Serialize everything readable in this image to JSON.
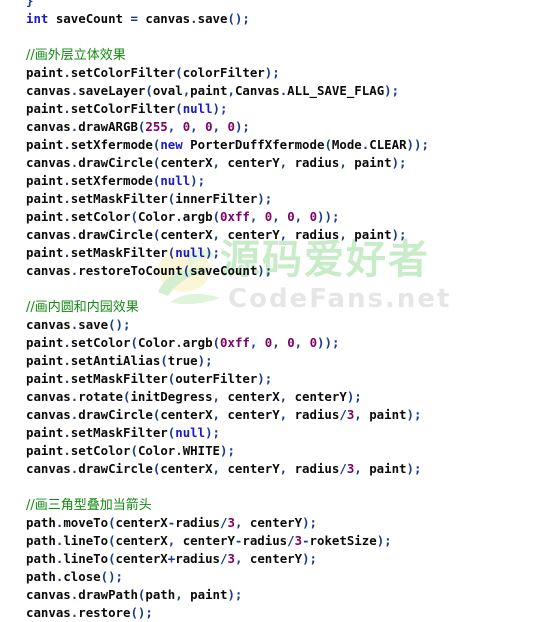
{
  "colors": {
    "keyword": "#1a1acc",
    "number": "#800066",
    "punctuation": "#1a3a8a",
    "identifier": "#0a0a0a",
    "comment": "#138a13",
    "watermark_cn": "#c8ebc8",
    "watermark_en": "#e6e6e6",
    "background": "#ffffff"
  },
  "watermark": {
    "logo_icon": "leaf-logo-icon",
    "chinese_text": "源码爱好者",
    "english_text": "CodeFans.net"
  },
  "code_lines": [
    [
      {
        "t": "p",
        "v": "}"
      }
    ],
    [
      {
        "t": "k",
        "v": "int"
      },
      {
        "t": "i",
        "v": " saveCount "
      },
      {
        "t": "p",
        "v": "="
      },
      {
        "t": "i",
        "v": " canvas"
      },
      {
        "t": "p",
        "v": "."
      },
      {
        "t": "i",
        "v": "save"
      },
      {
        "t": "p",
        "v": "();"
      }
    ],
    [],
    [
      {
        "t": "c",
        "v": "//画外层立体效果"
      }
    ],
    [
      {
        "t": "i",
        "v": "paint"
      },
      {
        "t": "p",
        "v": "."
      },
      {
        "t": "i",
        "v": "setColorFilter"
      },
      {
        "t": "p",
        "v": "("
      },
      {
        "t": "i",
        "v": "colorFilter"
      },
      {
        "t": "p",
        "v": ");"
      }
    ],
    [
      {
        "t": "i",
        "v": "canvas"
      },
      {
        "t": "p",
        "v": "."
      },
      {
        "t": "i",
        "v": "saveLayer"
      },
      {
        "t": "p",
        "v": "("
      },
      {
        "t": "i",
        "v": "oval"
      },
      {
        "t": "p",
        "v": ","
      },
      {
        "t": "i",
        "v": "paint"
      },
      {
        "t": "p",
        "v": ","
      },
      {
        "t": "i",
        "v": "Canvas"
      },
      {
        "t": "p",
        "v": "."
      },
      {
        "t": "i",
        "v": "ALL_SAVE_FLAG"
      },
      {
        "t": "p",
        "v": ");"
      }
    ],
    [
      {
        "t": "i",
        "v": "paint"
      },
      {
        "t": "p",
        "v": "."
      },
      {
        "t": "i",
        "v": "setColorFilter"
      },
      {
        "t": "p",
        "v": "("
      },
      {
        "t": "k",
        "v": "null"
      },
      {
        "t": "p",
        "v": ");"
      }
    ],
    [
      {
        "t": "i",
        "v": "canvas"
      },
      {
        "t": "p",
        "v": "."
      },
      {
        "t": "i",
        "v": "drawARGB"
      },
      {
        "t": "p",
        "v": "("
      },
      {
        "t": "n",
        "v": "255"
      },
      {
        "t": "p",
        "v": ", "
      },
      {
        "t": "n",
        "v": "0"
      },
      {
        "t": "p",
        "v": ", "
      },
      {
        "t": "n",
        "v": "0"
      },
      {
        "t": "p",
        "v": ", "
      },
      {
        "t": "n",
        "v": "0"
      },
      {
        "t": "p",
        "v": ");"
      }
    ],
    [
      {
        "t": "i",
        "v": "paint"
      },
      {
        "t": "p",
        "v": "."
      },
      {
        "t": "i",
        "v": "setXfermode"
      },
      {
        "t": "p",
        "v": "("
      },
      {
        "t": "k",
        "v": "new"
      },
      {
        "t": "i",
        "v": " PorterDuffXfermode"
      },
      {
        "t": "p",
        "v": "("
      },
      {
        "t": "i",
        "v": "Mode"
      },
      {
        "t": "p",
        "v": "."
      },
      {
        "t": "i",
        "v": "CLEAR"
      },
      {
        "t": "p",
        "v": "));"
      }
    ],
    [
      {
        "t": "i",
        "v": "canvas"
      },
      {
        "t": "p",
        "v": "."
      },
      {
        "t": "i",
        "v": "drawCircle"
      },
      {
        "t": "p",
        "v": "("
      },
      {
        "t": "i",
        "v": "centerX"
      },
      {
        "t": "p",
        "v": ", "
      },
      {
        "t": "i",
        "v": "centerY"
      },
      {
        "t": "p",
        "v": ", "
      },
      {
        "t": "i",
        "v": "radius"
      },
      {
        "t": "p",
        "v": ", "
      },
      {
        "t": "i",
        "v": "paint"
      },
      {
        "t": "p",
        "v": ");"
      }
    ],
    [
      {
        "t": "i",
        "v": "paint"
      },
      {
        "t": "p",
        "v": "."
      },
      {
        "t": "i",
        "v": "setXfermode"
      },
      {
        "t": "p",
        "v": "("
      },
      {
        "t": "k",
        "v": "null"
      },
      {
        "t": "p",
        "v": ");"
      }
    ],
    [
      {
        "t": "i",
        "v": "paint"
      },
      {
        "t": "p",
        "v": "."
      },
      {
        "t": "i",
        "v": "setMaskFilter"
      },
      {
        "t": "p",
        "v": "("
      },
      {
        "t": "i",
        "v": "innerFilter"
      },
      {
        "t": "p",
        "v": ");"
      }
    ],
    [
      {
        "t": "i",
        "v": "paint"
      },
      {
        "t": "p",
        "v": "."
      },
      {
        "t": "i",
        "v": "setColor"
      },
      {
        "t": "p",
        "v": "("
      },
      {
        "t": "i",
        "v": "Color"
      },
      {
        "t": "p",
        "v": "."
      },
      {
        "t": "i",
        "v": "argb"
      },
      {
        "t": "p",
        "v": "("
      },
      {
        "t": "n",
        "v": "0xff"
      },
      {
        "t": "p",
        "v": ", "
      },
      {
        "t": "n",
        "v": "0"
      },
      {
        "t": "p",
        "v": ", "
      },
      {
        "t": "n",
        "v": "0"
      },
      {
        "t": "p",
        "v": ", "
      },
      {
        "t": "n",
        "v": "0"
      },
      {
        "t": "p",
        "v": "));"
      }
    ],
    [
      {
        "t": "i",
        "v": "canvas"
      },
      {
        "t": "p",
        "v": "."
      },
      {
        "t": "i",
        "v": "drawCircle"
      },
      {
        "t": "p",
        "v": "("
      },
      {
        "t": "i",
        "v": "centerX"
      },
      {
        "t": "p",
        "v": ", "
      },
      {
        "t": "i",
        "v": "centerY"
      },
      {
        "t": "p",
        "v": ", "
      },
      {
        "t": "i",
        "v": "radius"
      },
      {
        "t": "p",
        "v": ", "
      },
      {
        "t": "i",
        "v": "paint"
      },
      {
        "t": "p",
        "v": ");"
      }
    ],
    [
      {
        "t": "i",
        "v": "paint"
      },
      {
        "t": "p",
        "v": "."
      },
      {
        "t": "i",
        "v": "setMaskFilter"
      },
      {
        "t": "p",
        "v": "("
      },
      {
        "t": "k",
        "v": "null"
      },
      {
        "t": "p",
        "v": ");"
      }
    ],
    [
      {
        "t": "i",
        "v": "canvas"
      },
      {
        "t": "p",
        "v": "."
      },
      {
        "t": "i",
        "v": "restoreToCount"
      },
      {
        "t": "p",
        "v": "("
      },
      {
        "t": "i",
        "v": "saveCount"
      },
      {
        "t": "p",
        "v": ");"
      }
    ],
    [],
    [
      {
        "t": "c",
        "v": "//画内圆和内园效果"
      }
    ],
    [
      {
        "t": "i",
        "v": "canvas"
      },
      {
        "t": "p",
        "v": "."
      },
      {
        "t": "i",
        "v": "save"
      },
      {
        "t": "p",
        "v": "();"
      }
    ],
    [
      {
        "t": "i",
        "v": "paint"
      },
      {
        "t": "p",
        "v": "."
      },
      {
        "t": "i",
        "v": "setColor"
      },
      {
        "t": "p",
        "v": "("
      },
      {
        "t": "i",
        "v": "Color"
      },
      {
        "t": "p",
        "v": "."
      },
      {
        "t": "i",
        "v": "argb"
      },
      {
        "t": "p",
        "v": "("
      },
      {
        "t": "n",
        "v": "0xff"
      },
      {
        "t": "p",
        "v": ", "
      },
      {
        "t": "n",
        "v": "0"
      },
      {
        "t": "p",
        "v": ", "
      },
      {
        "t": "n",
        "v": "0"
      },
      {
        "t": "p",
        "v": ", "
      },
      {
        "t": "n",
        "v": "0"
      },
      {
        "t": "p",
        "v": "));"
      }
    ],
    [
      {
        "t": "i",
        "v": "paint"
      },
      {
        "t": "p",
        "v": "."
      },
      {
        "t": "i",
        "v": "setAntiAlias"
      },
      {
        "t": "p",
        "v": "("
      },
      {
        "t": "i",
        "v": "true"
      },
      {
        "t": "p",
        "v": ");"
      }
    ],
    [
      {
        "t": "i",
        "v": "paint"
      },
      {
        "t": "p",
        "v": "."
      },
      {
        "t": "i",
        "v": "setMaskFilter"
      },
      {
        "t": "p",
        "v": "("
      },
      {
        "t": "i",
        "v": "outerFilter"
      },
      {
        "t": "p",
        "v": ");"
      }
    ],
    [
      {
        "t": "i",
        "v": "canvas"
      },
      {
        "t": "p",
        "v": "."
      },
      {
        "t": "i",
        "v": "rotate"
      },
      {
        "t": "p",
        "v": "("
      },
      {
        "t": "i",
        "v": "initDegress"
      },
      {
        "t": "p",
        "v": ", "
      },
      {
        "t": "i",
        "v": "centerX"
      },
      {
        "t": "p",
        "v": ", "
      },
      {
        "t": "i",
        "v": "centerY"
      },
      {
        "t": "p",
        "v": ");"
      }
    ],
    [
      {
        "t": "i",
        "v": "canvas"
      },
      {
        "t": "p",
        "v": "."
      },
      {
        "t": "i",
        "v": "drawCircle"
      },
      {
        "t": "p",
        "v": "("
      },
      {
        "t": "i",
        "v": "centerX"
      },
      {
        "t": "p",
        "v": ", "
      },
      {
        "t": "i",
        "v": "centerY"
      },
      {
        "t": "p",
        "v": ", "
      },
      {
        "t": "i",
        "v": "radius"
      },
      {
        "t": "p",
        "v": "/"
      },
      {
        "t": "n",
        "v": "3"
      },
      {
        "t": "p",
        "v": ", "
      },
      {
        "t": "i",
        "v": "paint"
      },
      {
        "t": "p",
        "v": ");"
      }
    ],
    [
      {
        "t": "i",
        "v": "paint"
      },
      {
        "t": "p",
        "v": "."
      },
      {
        "t": "i",
        "v": "setMaskFilter"
      },
      {
        "t": "p",
        "v": "("
      },
      {
        "t": "k",
        "v": "null"
      },
      {
        "t": "p",
        "v": ");"
      }
    ],
    [
      {
        "t": "i",
        "v": "paint"
      },
      {
        "t": "p",
        "v": "."
      },
      {
        "t": "i",
        "v": "setColor"
      },
      {
        "t": "p",
        "v": "("
      },
      {
        "t": "i",
        "v": "Color"
      },
      {
        "t": "p",
        "v": "."
      },
      {
        "t": "i",
        "v": "WHITE"
      },
      {
        "t": "p",
        "v": ");"
      }
    ],
    [
      {
        "t": "i",
        "v": "canvas"
      },
      {
        "t": "p",
        "v": "."
      },
      {
        "t": "i",
        "v": "drawCircle"
      },
      {
        "t": "p",
        "v": "("
      },
      {
        "t": "i",
        "v": "centerX"
      },
      {
        "t": "p",
        "v": ", "
      },
      {
        "t": "i",
        "v": "centerY"
      },
      {
        "t": "p",
        "v": ", "
      },
      {
        "t": "i",
        "v": "radius"
      },
      {
        "t": "p",
        "v": "/"
      },
      {
        "t": "n",
        "v": "3"
      },
      {
        "t": "p",
        "v": ", "
      },
      {
        "t": "i",
        "v": "paint"
      },
      {
        "t": "p",
        "v": ");"
      }
    ],
    [],
    [
      {
        "t": "c",
        "v": "//画三角型叠加当箭头"
      }
    ],
    [
      {
        "t": "i",
        "v": "path"
      },
      {
        "t": "p",
        "v": "."
      },
      {
        "t": "i",
        "v": "moveTo"
      },
      {
        "t": "p",
        "v": "("
      },
      {
        "t": "i",
        "v": "centerX"
      },
      {
        "t": "p",
        "v": "-"
      },
      {
        "t": "i",
        "v": "radius"
      },
      {
        "t": "p",
        "v": "/"
      },
      {
        "t": "n",
        "v": "3"
      },
      {
        "t": "p",
        "v": ", "
      },
      {
        "t": "i",
        "v": "centerY"
      },
      {
        "t": "p",
        "v": ");"
      }
    ],
    [
      {
        "t": "i",
        "v": "path"
      },
      {
        "t": "p",
        "v": "."
      },
      {
        "t": "i",
        "v": "lineTo"
      },
      {
        "t": "p",
        "v": "("
      },
      {
        "t": "i",
        "v": "centerX"
      },
      {
        "t": "p",
        "v": ", "
      },
      {
        "t": "i",
        "v": "centerY"
      },
      {
        "t": "p",
        "v": "-"
      },
      {
        "t": "i",
        "v": "radius"
      },
      {
        "t": "p",
        "v": "/"
      },
      {
        "t": "n",
        "v": "3"
      },
      {
        "t": "p",
        "v": "-"
      },
      {
        "t": "i",
        "v": "roketSize"
      },
      {
        "t": "p",
        "v": ");"
      }
    ],
    [
      {
        "t": "i",
        "v": "path"
      },
      {
        "t": "p",
        "v": "."
      },
      {
        "t": "i",
        "v": "lineTo"
      },
      {
        "t": "p",
        "v": "("
      },
      {
        "t": "i",
        "v": "centerX"
      },
      {
        "t": "p",
        "v": "+"
      },
      {
        "t": "i",
        "v": "radius"
      },
      {
        "t": "p",
        "v": "/"
      },
      {
        "t": "n",
        "v": "3"
      },
      {
        "t": "p",
        "v": ", "
      },
      {
        "t": "i",
        "v": "centerY"
      },
      {
        "t": "p",
        "v": ");"
      }
    ],
    [
      {
        "t": "i",
        "v": "path"
      },
      {
        "t": "p",
        "v": "."
      },
      {
        "t": "i",
        "v": "close"
      },
      {
        "t": "p",
        "v": "();"
      }
    ],
    [
      {
        "t": "i",
        "v": "canvas"
      },
      {
        "t": "p",
        "v": "."
      },
      {
        "t": "i",
        "v": "drawPath"
      },
      {
        "t": "p",
        "v": "("
      },
      {
        "t": "i",
        "v": "path"
      },
      {
        "t": "p",
        "v": ", "
      },
      {
        "t": "i",
        "v": "paint"
      },
      {
        "t": "p",
        "v": ");"
      }
    ],
    [
      {
        "t": "i",
        "v": "canvas"
      },
      {
        "t": "p",
        "v": "."
      },
      {
        "t": "i",
        "v": "restore"
      },
      {
        "t": "p",
        "v": "();"
      }
    ]
  ]
}
